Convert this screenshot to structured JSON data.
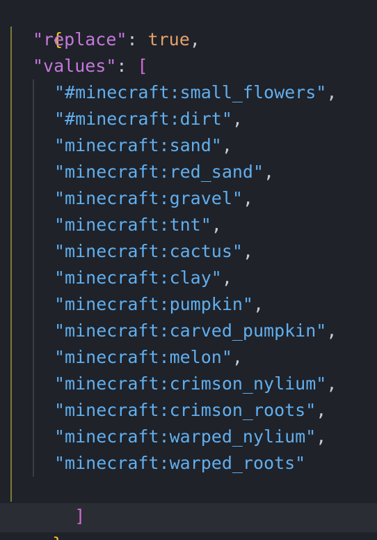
{
  "editor": {
    "open_brace": "{",
    "close_brace": "}",
    "replace_key": "\"replace\"",
    "replace_value": "true",
    "values_key": "\"values\"",
    "open_bracket": "[",
    "close_bracket": "]",
    "colon": ": ",
    "comma": ",",
    "values": [
      "\"#minecraft:small_flowers\"",
      "\"#minecraft:dirt\"",
      "\"minecraft:sand\"",
      "\"minecraft:red_sand\"",
      "\"minecraft:gravel\"",
      "\"minecraft:tnt\"",
      "\"minecraft:cactus\"",
      "\"minecraft:clay\"",
      "\"minecraft:pumpkin\"",
      "\"minecraft:carved_pumpkin\"",
      "\"minecraft:melon\"",
      "\"minecraft:crimson_nylium\"",
      "\"minecraft:crimson_roots\"",
      "\"minecraft:warped_nylium\"",
      "\"minecraft:warped_roots\""
    ],
    "colors": {
      "background": "#1f2229",
      "brace": "#f0c428",
      "bracket": "#d26bd6",
      "key": "#c678dd",
      "string": "#61afef",
      "boolean": "#e6a26a"
    }
  }
}
